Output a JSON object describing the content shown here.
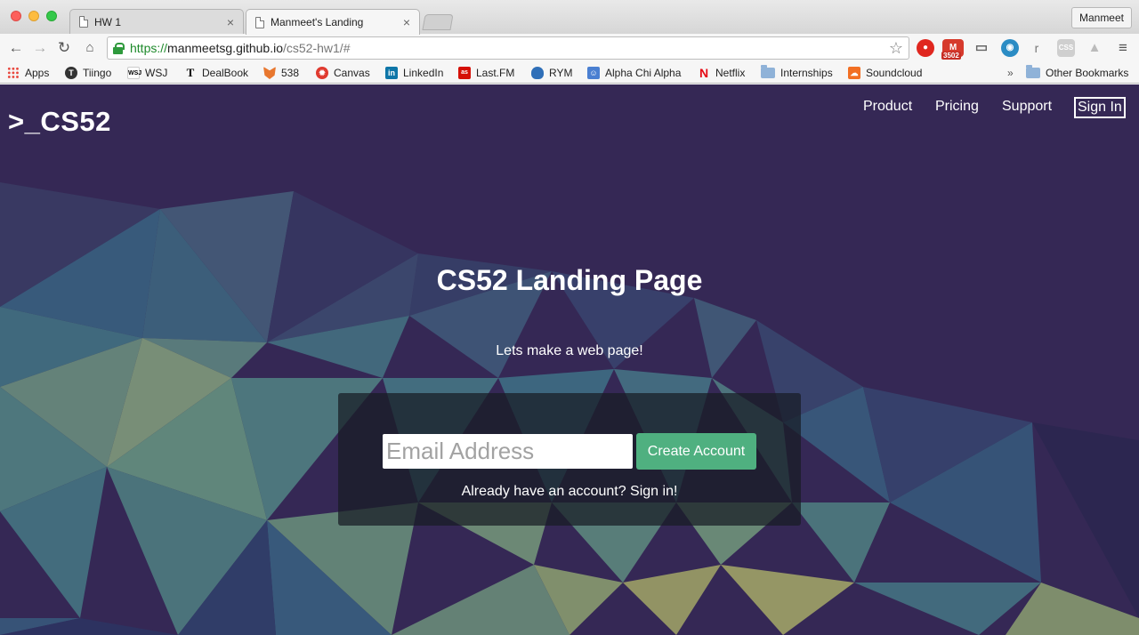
{
  "browser": {
    "tabs": [
      {
        "title": "HW 1",
        "close": "×"
      },
      {
        "title": "Manmeet's Landing",
        "close": "×"
      }
    ],
    "profile": "Manmeet",
    "url": {
      "scheme": "https://",
      "host": "manmeetsg.github.io",
      "path": "/cs52-hw1/#"
    },
    "badge_count": "3502",
    "bookmarks": [
      {
        "label": "Apps",
        "icon": "apps-grid-icon"
      },
      {
        "label": "Tiingo",
        "icon": "tiingo-icon"
      },
      {
        "label": "WSJ",
        "icon": "wsj-icon"
      },
      {
        "label": "DealBook",
        "icon": "nyt-icon"
      },
      {
        "label": "538",
        "icon": "fox-icon"
      },
      {
        "label": "Canvas",
        "icon": "canvas-icon"
      },
      {
        "label": "LinkedIn",
        "icon": "linkedin-icon"
      },
      {
        "label": "Last.FM",
        "icon": "lastfm-icon"
      },
      {
        "label": "RYM",
        "icon": "rym-icon"
      },
      {
        "label": "Alpha Chi Alpha",
        "icon": "bookmark-icon"
      },
      {
        "label": "Netflix",
        "icon": "netflix-icon"
      },
      {
        "label": "Internships",
        "icon": "folder-icon"
      },
      {
        "label": "Soundcloud",
        "icon": "soundcloud-icon"
      },
      {
        "label": "Other Bookmarks",
        "icon": "folder-icon"
      }
    ],
    "overflow": "»"
  },
  "site": {
    "logo": ">_CS52",
    "nav": {
      "product": "Product",
      "pricing": "Pricing",
      "support": "Support",
      "signin": "Sign In"
    },
    "hero": {
      "title": "CS52 Landing Page",
      "subtitle": "Lets make a web page!"
    },
    "signup": {
      "email_placeholder": "Email Address",
      "email_value": "",
      "create_button": "Create Account",
      "already": "Already have an account? Sign in!"
    }
  },
  "colors": {
    "accent_button": "#4fb080",
    "page_bg": "#3a2c57"
  }
}
